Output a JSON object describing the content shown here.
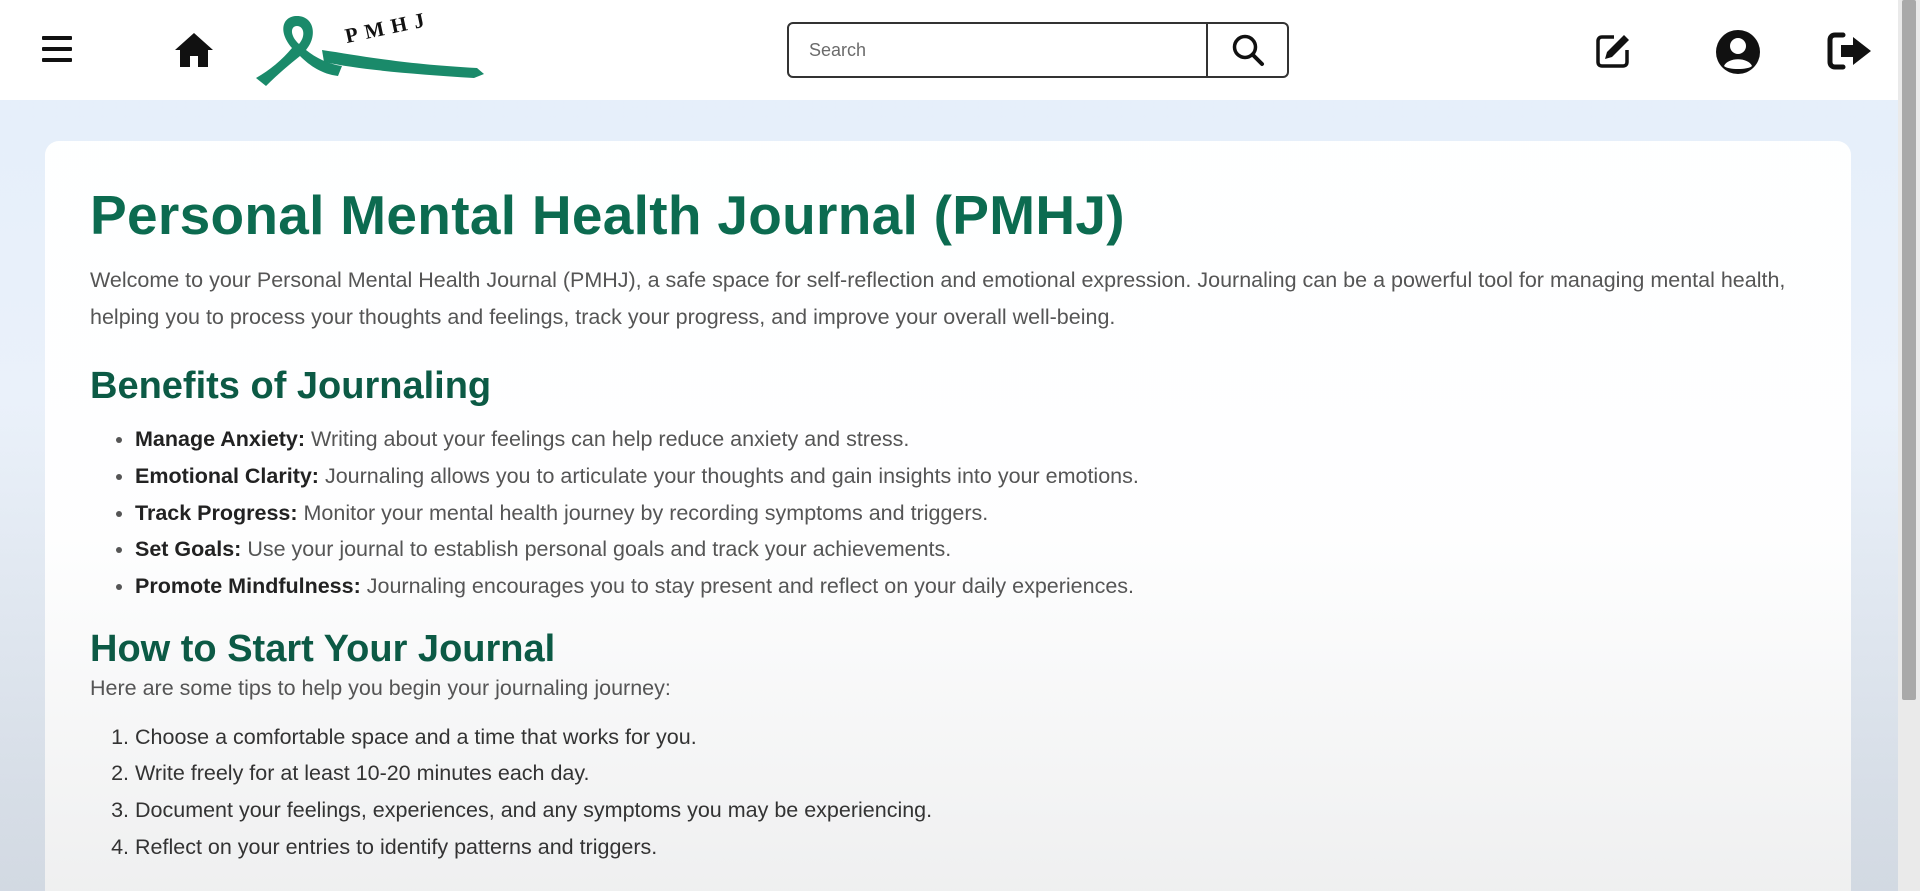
{
  "header": {
    "logo_text": "PMHJ",
    "search": {
      "placeholder": "Search",
      "value": ""
    },
    "icons": [
      "menu-icon",
      "home-icon",
      "search-icon",
      "edit-icon",
      "user-circle-icon",
      "logout-icon"
    ]
  },
  "colors": {
    "title": "#0c6b50",
    "heading": "#0c5a45",
    "logo_ribbon": "#1a8a6a"
  },
  "main": {
    "title": "Personal Mental Health Journal (PMHJ)",
    "intro": "Welcome to your Personal Mental Health Journal (PMHJ), a safe space for self-reflection and emotional expression. Journaling can be a powerful tool for managing mental health, helping you to process your thoughts and feelings, track your progress, and improve your overall well-being.",
    "benefits": {
      "heading": "Benefits of Journaling",
      "items": [
        {
          "term": "Manage Anxiety:",
          "text": " Writing about your feelings can help reduce anxiety and stress."
        },
        {
          "term": "Emotional Clarity:",
          "text": " Journaling allows you to articulate your thoughts and gain insights into your emotions."
        },
        {
          "term": "Track Progress:",
          "text": " Monitor your mental health journey by recording symptoms and triggers."
        },
        {
          "term": "Set Goals:",
          "text": " Use your journal to establish personal goals and track your achievements."
        },
        {
          "term": "Promote Mindfulness:",
          "text": " Journaling encourages you to stay present and reflect on your daily experiences."
        }
      ]
    },
    "start": {
      "heading": "How to Start Your Journal",
      "intro": "Here are some tips to help you begin your journaling journey:",
      "steps": [
        "Choose a comfortable space and a time that works for you.",
        "Write freely for at least 10-20 minutes each day.",
        "Document your feelings, experiences, and any symptoms you may be experiencing.",
        "Reflect on your entries to identify patterns and triggers."
      ]
    }
  }
}
